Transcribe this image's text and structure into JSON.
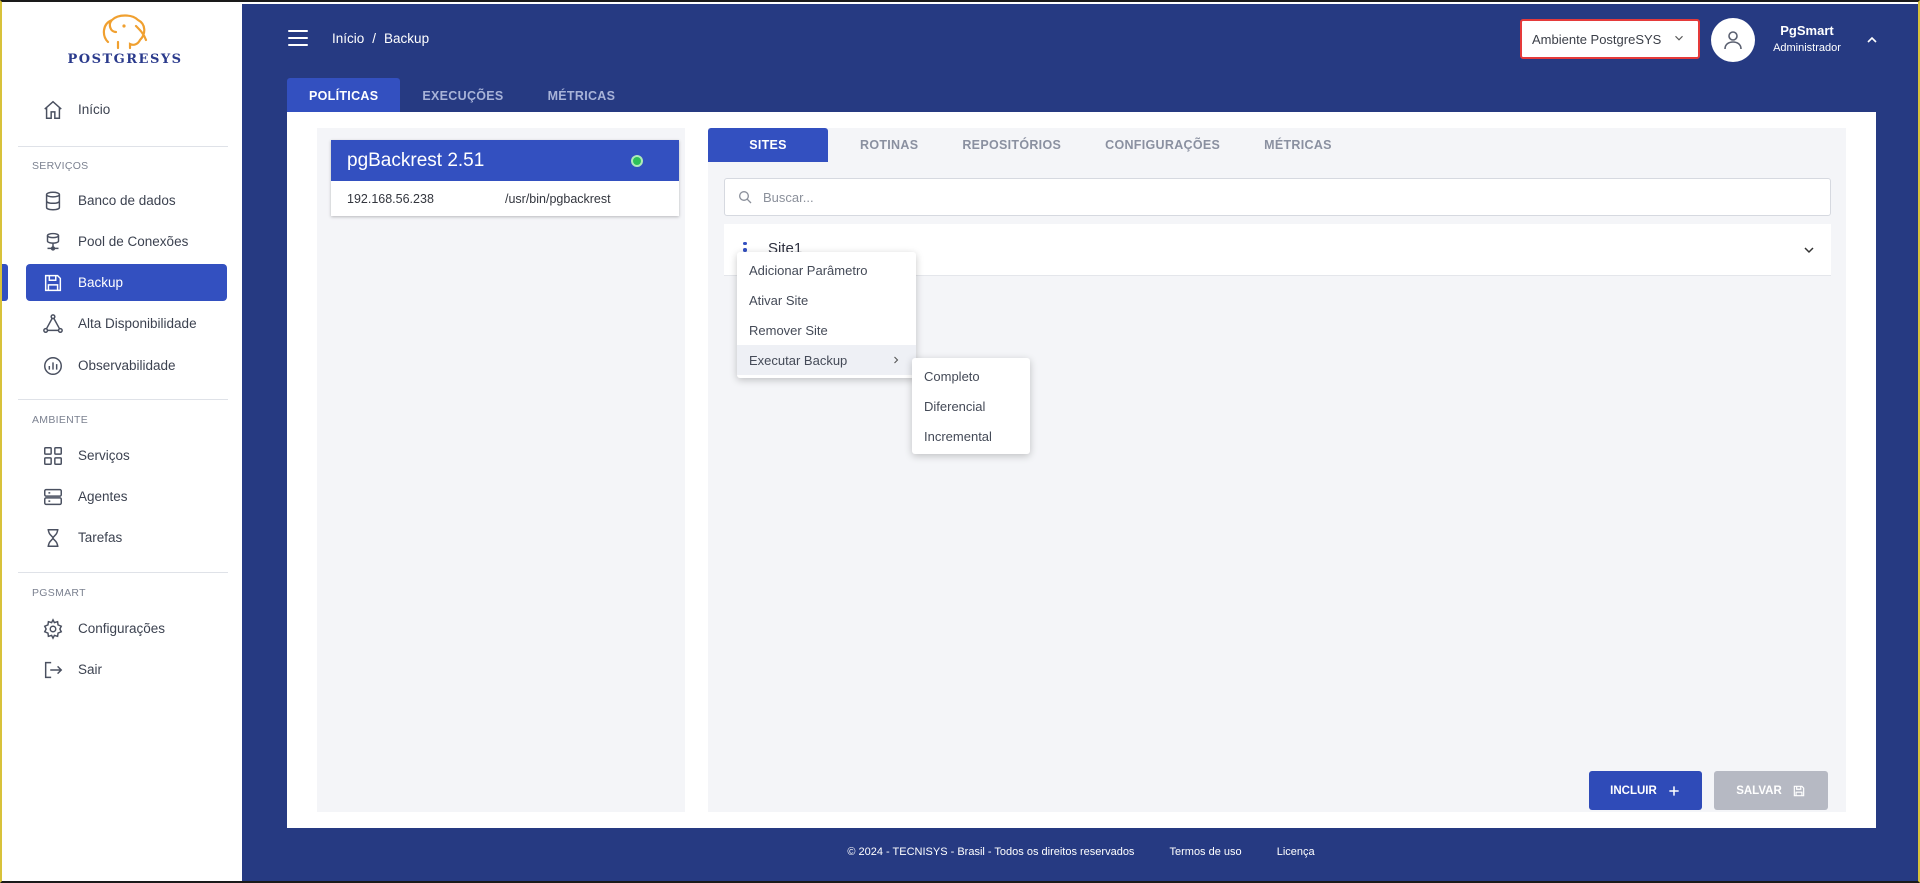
{
  "sidebar": {
    "logo_text": "POSTGRESYS",
    "sections": {
      "servicos": "SERVIÇOS",
      "ambiente": "AMBIENTE",
      "pgsmart": "PGSMART"
    },
    "items": [
      {
        "label": "Início",
        "icon": "home-icon"
      },
      {
        "label": "Banco de dados",
        "icon": "database-icon"
      },
      {
        "label": "Pool de Conexões",
        "icon": "connection-pool-icon"
      },
      {
        "label": "Backup",
        "icon": "save-icon",
        "active": true
      },
      {
        "label": "Alta Disponibilidade",
        "icon": "network-icon"
      },
      {
        "label": "Observabilidade",
        "icon": "chart-icon"
      },
      {
        "label": "Serviços",
        "icon": "grid-icon"
      },
      {
        "label": "Agentes",
        "icon": "server-icon"
      },
      {
        "label": "Tarefas",
        "icon": "hourglass-icon"
      },
      {
        "label": "Configurações",
        "icon": "gear-icon"
      },
      {
        "label": "Sair",
        "icon": "logout-icon"
      }
    ]
  },
  "header": {
    "breadcrumb": [
      "Início",
      "/",
      "Backup"
    ],
    "environment": "Ambiente PostgreSYS",
    "user_name": "PgSmart",
    "user_role": "Administrador"
  },
  "top_tabs": [
    "POLÍTICAS",
    "EXECUÇÕES",
    "MÉTRICAS"
  ],
  "agent": {
    "title": "pgBackrest 2.51",
    "ip": "192.168.56.238",
    "path": "/usr/bin/pgbackrest",
    "status_color": "#2ec05a"
  },
  "inner_tabs": [
    "SITES",
    "ROTINAS",
    "REPOSITÓRIOS",
    "CONFIGURAÇÕES",
    "MÉTRICAS"
  ],
  "search": {
    "placeholder": "Buscar..."
  },
  "site": {
    "name": "Site1"
  },
  "context_menu": [
    "Adicionar Parâmetro",
    "Ativar Site",
    "Remover Site",
    "Executar Backup"
  ],
  "submenu": [
    "Completo",
    "Diferencial",
    "Incremental"
  ],
  "buttons": {
    "incluir": "INCLUIR",
    "salvar": "SALVAR"
  },
  "footer": {
    "copyright": "© 2024 - TECNISYS - Brasil - Todos os direitos reservados",
    "terms": "Termos de uso",
    "license": "Licença"
  },
  "colors": {
    "primary": "#3350c0",
    "background": "#263a82",
    "logo_orange": "#f0a030"
  }
}
